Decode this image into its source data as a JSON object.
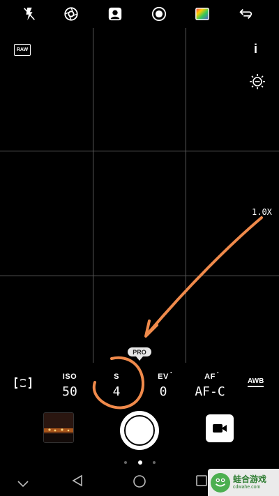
{
  "top_bar": {
    "icons": [
      "flash-off-icon",
      "aperture-icon",
      "portrait-icon",
      "hdr-icon",
      "filter-icon",
      "switch-camera-icon"
    ]
  },
  "viewfinder": {
    "raw_label": "RAW",
    "info_label": "i",
    "zoom_label": "1.0X",
    "settings_icon": "brightness-icon"
  },
  "pro_mode": {
    "badge_label": "PRO"
  },
  "params": [
    {
      "label": "ISO",
      "value": "50",
      "superscript": ""
    },
    {
      "label": "S",
      "value": "4",
      "superscript": ""
    },
    {
      "label": "EV",
      "value": "0",
      "superscript": "•"
    },
    {
      "label": "AF",
      "value": "AF-C",
      "superscript": "•"
    }
  ],
  "white_balance": {
    "label": "AWB"
  },
  "annotation": {
    "color": "#f08a4b"
  },
  "page_indicator": {
    "count": 3,
    "active": 1
  },
  "nav": {
    "icons": [
      "hide-nav-icon",
      "back-icon",
      "home-icon",
      "recents-icon"
    ]
  },
  "watermark": {
    "title": "蛙合游戏",
    "url": "cdwahe.com"
  }
}
